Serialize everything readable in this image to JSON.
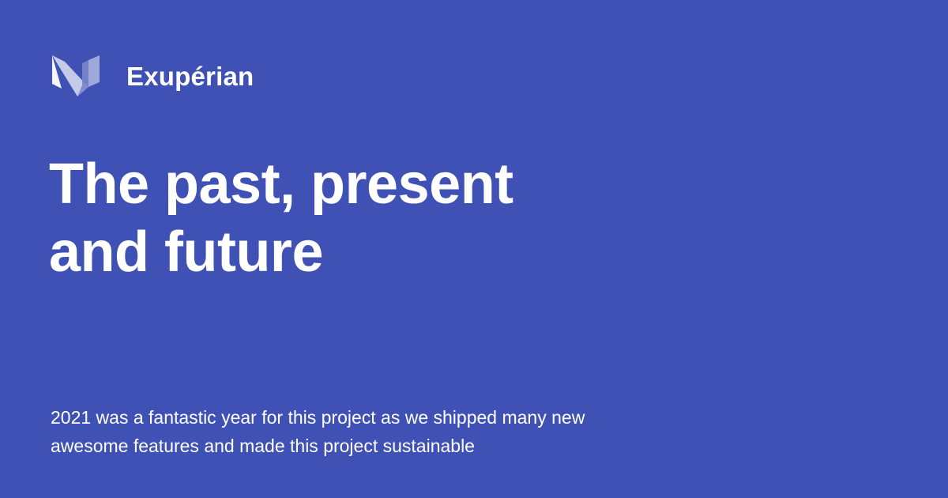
{
  "colors": {
    "background": "#3f51b5",
    "text": "#ffffff",
    "logo_light": "#ffffff",
    "logo_mid": "#c5cae9",
    "logo_dark": "#9fa8da"
  },
  "brand": {
    "logo_icon": "exuperian-logo-icon",
    "name": "Exupérian"
  },
  "headline": {
    "line1": "The past, present",
    "line2": "and future"
  },
  "description": {
    "line1": "2021 was a fantastic year for this project as we shipped many new",
    "line2": "awesome features and made this project sustainable"
  }
}
